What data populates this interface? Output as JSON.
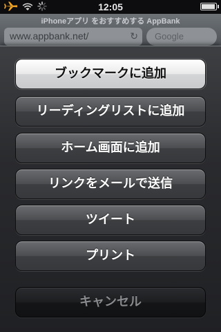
{
  "status_bar": {
    "time": "12:05",
    "icons": [
      "airplane-icon",
      "wifi-icon",
      "activity-spinner-icon",
      "battery-icon"
    ],
    "battery_level": 0.95
  },
  "browser": {
    "page_title": "iPhoneアプリ をおすすめする AppBank",
    "url": "www.appbank.net/",
    "search_placeholder": "Google"
  },
  "action_sheet": {
    "buttons": [
      {
        "label": "ブックマークに追加"
      },
      {
        "label": "リーディングリストに追加"
      },
      {
        "label": "ホーム画面に追加"
      },
      {
        "label": "リンクをメールで送信"
      },
      {
        "label": "ツイート"
      },
      {
        "label": "プリント"
      }
    ],
    "cancel_label": "キャンセル"
  },
  "colors": {
    "highlight_button": "#ffffff",
    "button": "#4b4d50",
    "cancel_button": "#1d1e20",
    "cancel_text": "#8a8b8e"
  }
}
